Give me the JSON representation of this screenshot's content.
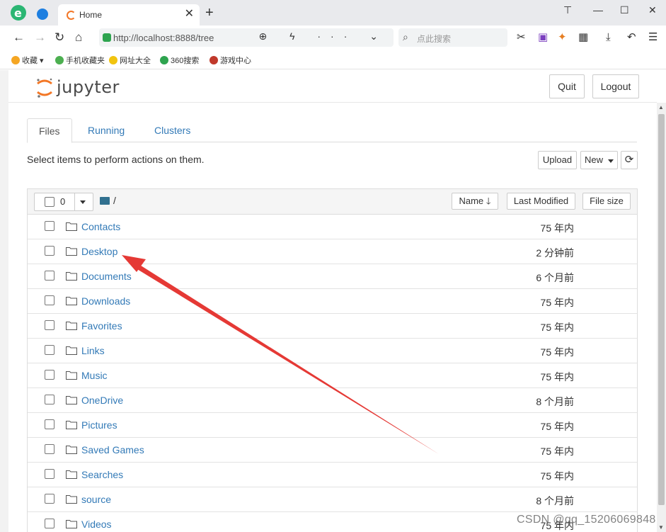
{
  "browser": {
    "tab_title": "Home",
    "tab_close": "✕",
    "new_tab": "+",
    "window_controls": [
      "⊤",
      "—",
      "☐",
      "✕"
    ],
    "url": "http://localhost:8888/tree",
    "addr_icons": "⊕ ϟ ··· ⌄",
    "search_placeholder": "点此搜索",
    "nav": {
      "back": "←",
      "forward": "→",
      "reload": "↻",
      "home": "⌂"
    },
    "bookmarks": [
      "收藏",
      "手机收藏夹",
      "网址大全",
      "360搜索",
      "游戏中心"
    ],
    "bookmark_colors": [
      "#f5a623",
      "#4caf50",
      "#f1c40f",
      "#2ea44f",
      "#c0392b"
    ]
  },
  "jupyter": {
    "logo_text": "jupyter",
    "quit_label": "Quit",
    "logout_label": "Logout",
    "tabs": [
      "Files",
      "Running",
      "Clusters"
    ],
    "active_tab": "Files",
    "hint": "Select items to perform actions on them.",
    "upload_label": "Upload",
    "new_label": "New",
    "refresh_icon": "⟳",
    "selected_count": "0",
    "breadcrumb": "/",
    "col_name": "Name",
    "col_sort_icon": "🡓",
    "col_modified": "Last Modified",
    "col_size": "File size",
    "rows": [
      {
        "name": "Contacts",
        "modified": "75 年内"
      },
      {
        "name": "Desktop",
        "modified": "2 分钟前"
      },
      {
        "name": "Documents",
        "modified": "6 个月前"
      },
      {
        "name": "Downloads",
        "modified": "75 年内"
      },
      {
        "name": "Favorites",
        "modified": "75 年内"
      },
      {
        "name": "Links",
        "modified": "75 年内"
      },
      {
        "name": "Music",
        "modified": "75 年内"
      },
      {
        "name": "OneDrive",
        "modified": "8 个月前"
      },
      {
        "name": "Pictures",
        "modified": "75 年内"
      },
      {
        "name": "Saved Games",
        "modified": "75 年内"
      },
      {
        "name": "Searches",
        "modified": "75 年内"
      },
      {
        "name": "source",
        "modified": "8 个月前"
      },
      {
        "name": "Videos",
        "modified": "75 年内"
      }
    ]
  },
  "annotation": {
    "arrow_color": "#e53935",
    "watermark": "CSDN @qq_15206069848"
  }
}
